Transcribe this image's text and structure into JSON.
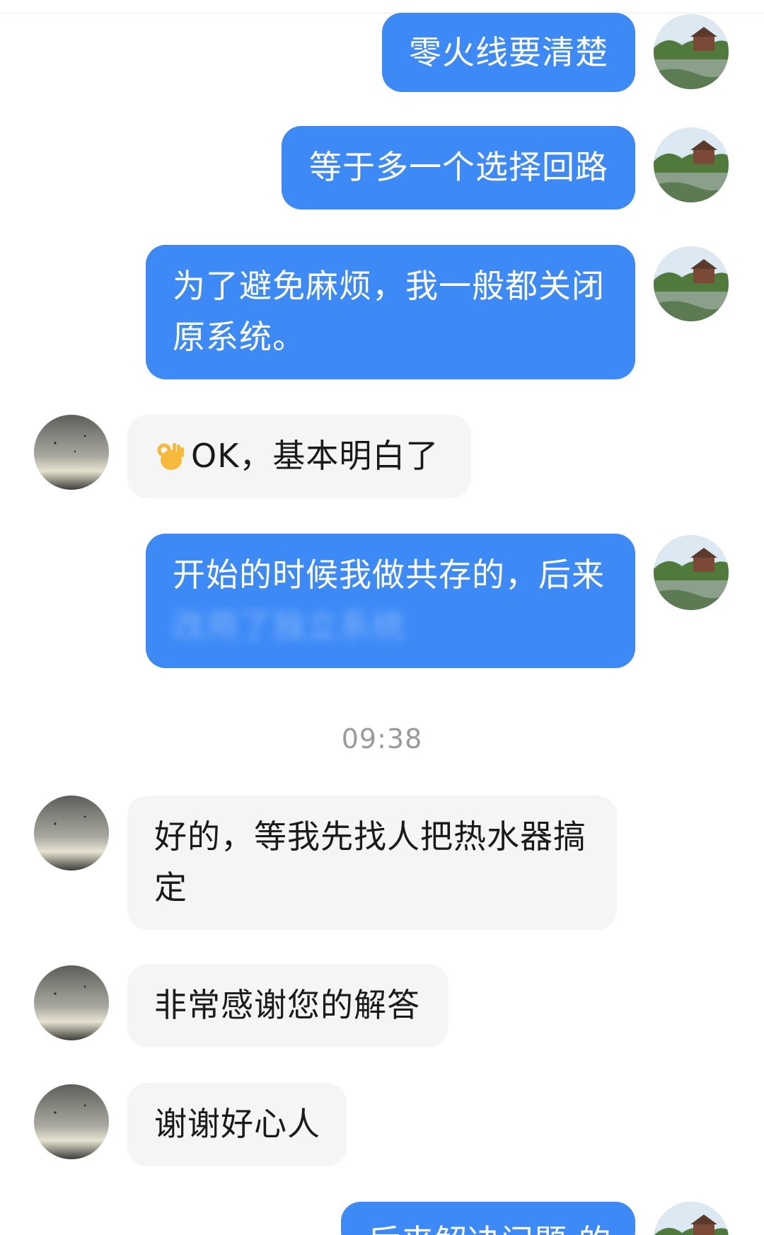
{
  "messages": {
    "m1": {
      "text": "零火线要清楚"
    },
    "m2": {
      "text": "等于多一个选择回路"
    },
    "m3": {
      "line1": "为了避免麻烦，我一般都关闭",
      "line2": "原系统。"
    },
    "m4": {
      "text": "OK，基本明白了",
      "emoji": "ok-hand-emoji"
    },
    "m5": {
      "line1": "开始的时候我做共存的，后来",
      "line2_blurred": "改用了独立系统"
    },
    "timestamp": "09:38",
    "m6": {
      "line1": "好的，等我先找人把热水器搞",
      "line2": "定"
    },
    "m7": {
      "text": "非常感谢您的解答"
    },
    "m8": {
      "text": "谢谢好心人"
    },
    "m9": {
      "text_partial": "后来解决问题 的"
    }
  },
  "colors": {
    "outgoing_bubble": "#3d8af7",
    "incoming_bubble": "#f5f5f5",
    "timestamp_text": "#9a9a9a"
  },
  "icons": {
    "self_avatar": "landscape-avatar",
    "other_avatar": "gray-sky-avatar"
  }
}
